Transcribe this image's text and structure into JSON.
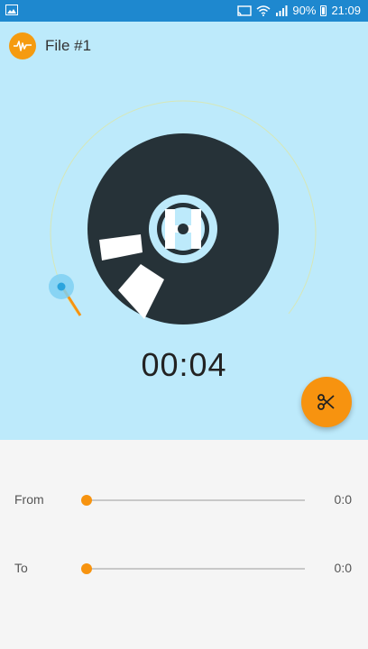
{
  "status_bar": {
    "battery": "90%",
    "time": "21:09"
  },
  "header": {
    "title": "File #1"
  },
  "player": {
    "time": "00:04"
  },
  "trim": {
    "from_label": "From",
    "from_value": "0:0",
    "to_label": "To",
    "to_value": "0:0"
  },
  "colors": {
    "status_bar": "#1e88cf",
    "background": "#bdeafb",
    "accent": "#f7930f",
    "disc": "#263238"
  },
  "icons": {
    "app": "waveform-icon",
    "fab": "scissors-icon"
  }
}
